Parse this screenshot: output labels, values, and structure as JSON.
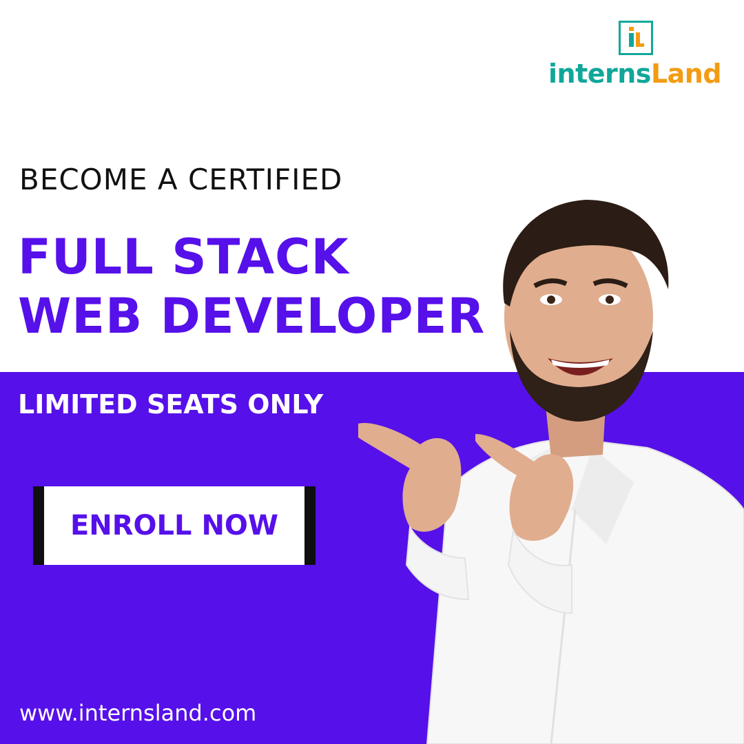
{
  "brand": {
    "logo_part1": "interns",
    "logo_part2": "Land",
    "mark_text": "iL"
  },
  "hero": {
    "eyebrow": "BECOME A CERTIFIED",
    "headline_line1": "FULL STACK",
    "headline_line2": "WEB DEVELOPER",
    "subline": "LIMITED SEATS ONLY"
  },
  "cta": {
    "label": "ENROLL NOW"
  },
  "footer": {
    "url": "www.internsland.com"
  },
  "colors": {
    "primary": "#5610ea",
    "teal": "#10a79a",
    "orange": "#f39c12",
    "cta_border": "#0f0f0f"
  },
  "image": {
    "subject": "photo-smiling-man-pointing"
  }
}
